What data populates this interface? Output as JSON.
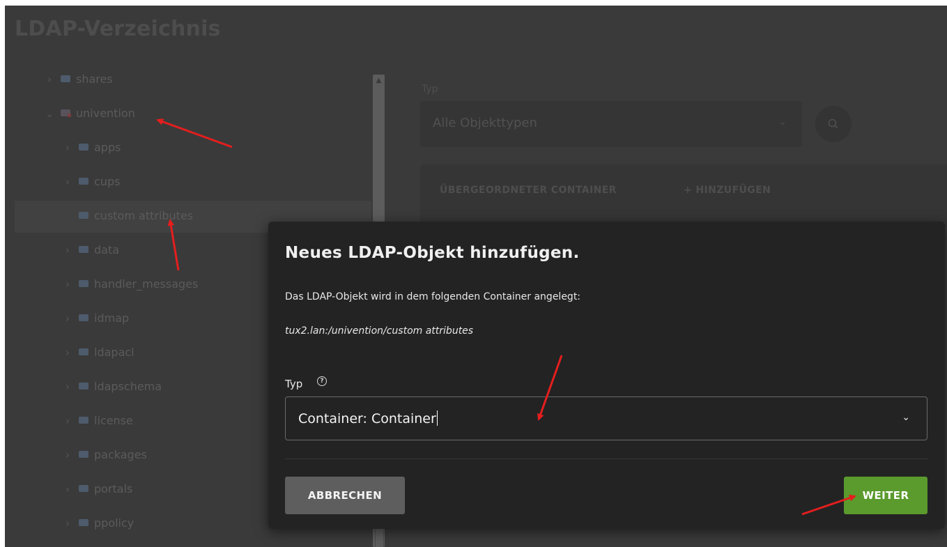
{
  "page": {
    "title": "LDAP-Verzeichnis"
  },
  "tree": {
    "items": [
      {
        "label": "shares",
        "expandable": true,
        "expanded": false,
        "indent": 0
      },
      {
        "label": "univention",
        "expandable": true,
        "expanded": true,
        "indent": 0,
        "icon": "special-container"
      },
      {
        "label": "apps",
        "expandable": true,
        "indent": 1
      },
      {
        "label": "cups",
        "expandable": true,
        "indent": 1
      },
      {
        "label": "custom attributes",
        "expandable": false,
        "indent": 1,
        "selected": true
      },
      {
        "label": "data",
        "expandable": true,
        "indent": 1
      },
      {
        "label": "handler_messages",
        "expandable": true,
        "indent": 1
      },
      {
        "label": "idmap",
        "expandable": true,
        "indent": 1
      },
      {
        "label": "ldapacl",
        "expandable": true,
        "indent": 1
      },
      {
        "label": "ldapschema",
        "expandable": true,
        "indent": 1
      },
      {
        "label": "license",
        "expandable": true,
        "indent": 1
      },
      {
        "label": "packages",
        "expandable": true,
        "indent": 1
      },
      {
        "label": "portals",
        "expandable": true,
        "indent": 1
      },
      {
        "label": "ppolicy",
        "expandable": true,
        "indent": 1
      }
    ]
  },
  "filter": {
    "typ_label": "Typ",
    "typ_value": "Alle Objekttypen"
  },
  "toolbar": {
    "parent_label": "ÜBERGEORDNETER CONTAINER",
    "add_label": "+ HINZUFÜGEN"
  },
  "dialog": {
    "title": "Neues LDAP-Objekt hinzufügen.",
    "description": "Das LDAP-Objekt wird in dem folgenden Container angelegt:",
    "path": "tux2.lan:/univention/custom attributes",
    "typ_label": "Typ",
    "typ_value": "Container: Container",
    "cancel_label": "ABBRECHEN",
    "next_label": "WEITER"
  },
  "colors": {
    "accent_green": "#5b9a2d",
    "annotation_red": "#e41e1e",
    "dialog_bg": "#232323"
  }
}
